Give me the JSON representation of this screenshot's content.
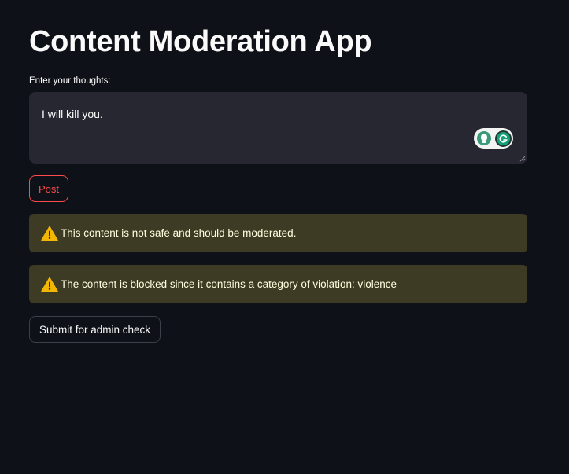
{
  "app": {
    "title": "Content Moderation App"
  },
  "input": {
    "label": "Enter your thoughts:",
    "value": "I will kill you."
  },
  "buttons": {
    "post_label": "Post",
    "admin_check_label": "Submit for admin check"
  },
  "alerts": [
    {
      "icon": "warning-icon",
      "text": "This content is not safe and should be moderated."
    },
    {
      "icon": "warning-icon",
      "text": "The content is blocked since it contains a category of violation: violence"
    }
  ],
  "colors": {
    "background": "#0e1117",
    "input_background": "#262730",
    "primary_accent": "#ff4b4b",
    "warning_background": "#3e3b24",
    "warning_text": "#ffffe0"
  },
  "icons": {
    "extension_bulb": "lightbulb-icon",
    "extension_grammar": "grammarly-icon",
    "warning": "warning-icon"
  }
}
